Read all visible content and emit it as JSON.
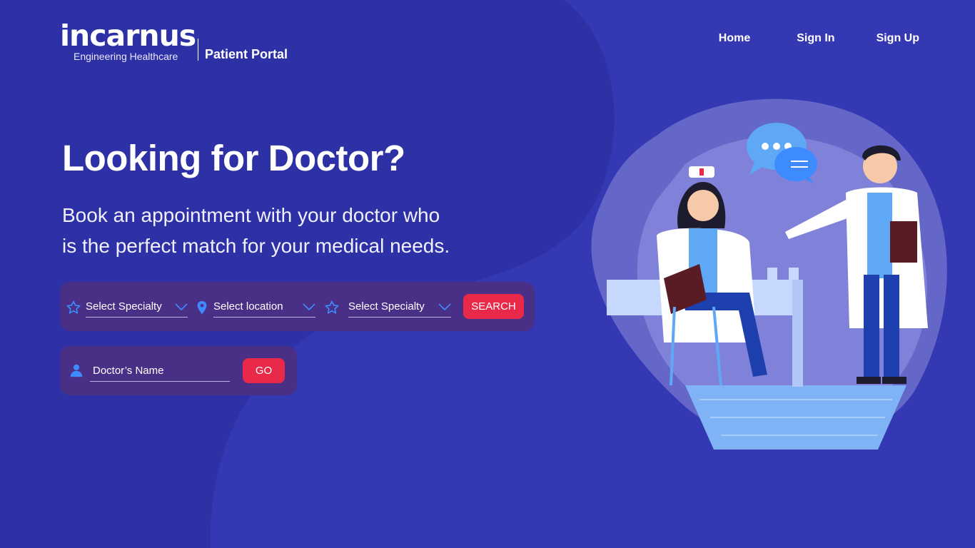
{
  "brand": {
    "name": "incarnus",
    "tagline": "Engineering Healthcare",
    "portal": "Patient Portal"
  },
  "nav": {
    "home": "Home",
    "sign_in": "Sign In",
    "sign_up": "Sign Up"
  },
  "hero": {
    "title": "Looking for Doctor?",
    "subtitle_line1": "Book an appointment with your doctor who",
    "subtitle_line2": "is the perfect match for your medical needs."
  },
  "search": {
    "specialty1": "Select Specialty",
    "location": "Select location",
    "specialty2": "Select Specialty",
    "button": "SEARCH"
  },
  "doctor_search": {
    "placeholder": "Doctor’s Name",
    "button": "GO"
  },
  "icons": {
    "specialty": "star-outline-icon",
    "location": "map-pin-icon",
    "doctor": "user-icon",
    "dropdown": "chevron-down-icon"
  },
  "colors": {
    "background": "#2d31a5",
    "accent": "#e8294a",
    "panel": "#4a2f86",
    "icon_blue": "#3d8bff"
  }
}
